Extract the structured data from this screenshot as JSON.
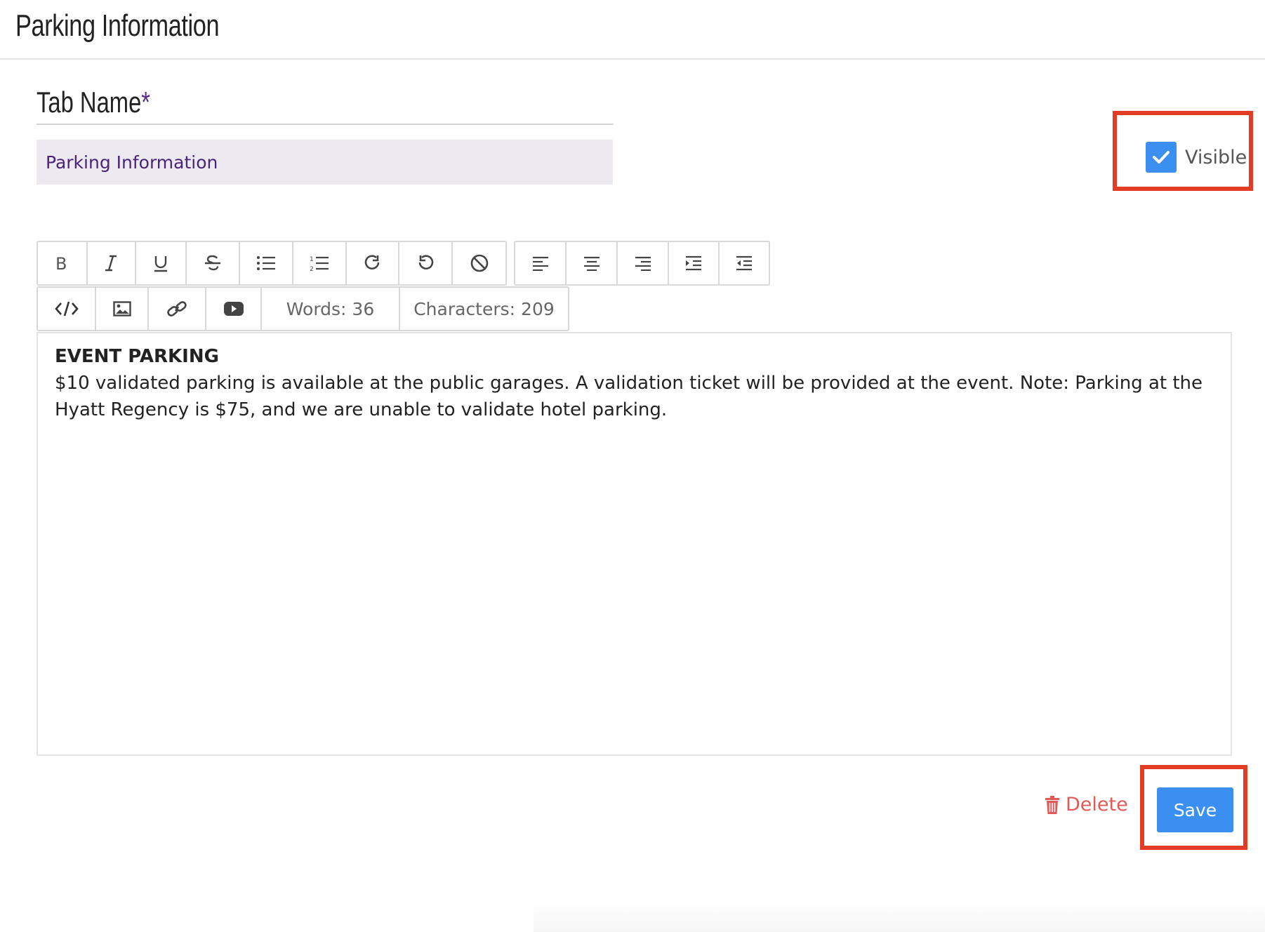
{
  "header": {
    "title": "Parking Information"
  },
  "form": {
    "tab_name_label": "Tab Name",
    "required_marker": "*",
    "tab_name_value": "Parking Information",
    "visible_label": "Visible",
    "visible_checked": true
  },
  "toolbar": {
    "row1_group1": [
      {
        "name": "bold-icon"
      },
      {
        "name": "italic-icon"
      },
      {
        "name": "underline-icon"
      },
      {
        "name": "strikethrough-icon"
      },
      {
        "name": "bulleted-list-icon"
      },
      {
        "name": "numbered-list-icon"
      },
      {
        "name": "redo-icon"
      },
      {
        "name": "undo-icon"
      },
      {
        "name": "clear-format-icon"
      }
    ],
    "row1_group2": [
      {
        "name": "align-left-icon"
      },
      {
        "name": "align-center-icon"
      },
      {
        "name": "align-right-icon"
      },
      {
        "name": "indent-icon"
      },
      {
        "name": "outdent-icon"
      }
    ],
    "row2": [
      {
        "name": "code-view-icon"
      },
      {
        "name": "image-icon"
      },
      {
        "name": "link-icon"
      },
      {
        "name": "video-icon"
      }
    ],
    "words_label": "Words: 36",
    "characters_label": "Characters: 209"
  },
  "editor": {
    "heading": "EVENT PARKING",
    "body": "$10 validated parking is available at the public garages. A validation ticket will be provided at the event. Note: Parking at the Hyatt Regency is $75, and we are unable to validate hotel parking."
  },
  "actions": {
    "delete_label": "Delete",
    "save_label": "Save"
  },
  "colors": {
    "accent_blue": "#3b8ff0",
    "required_purple": "#5a2a82",
    "delete_red": "#e05b57",
    "highlight_red": "#e23d24"
  }
}
